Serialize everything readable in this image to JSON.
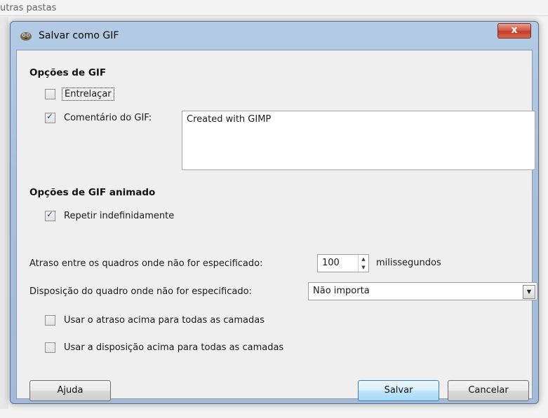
{
  "background": {
    "folder_text": "utras pastas"
  },
  "window": {
    "title": "Salvar como GIF",
    "close_label": "x"
  },
  "gif_options": {
    "section_title": "Opções de GIF",
    "interlace": {
      "label": "Entrelaçar",
      "checked": false
    },
    "comment": {
      "label": "Comentário do GIF:",
      "checked": true,
      "value": "Created with GIMP"
    }
  },
  "animated_options": {
    "section_title": "Opções de GIF animado",
    "loop": {
      "label": "Repetir indefinidamente",
      "checked": true
    },
    "delay": {
      "label": "Atraso entre os quadros onde não for especificado:",
      "value": "100",
      "unit": "milissegundos"
    },
    "disposal": {
      "label": "Disposição do quadro onde não for especificado:",
      "selected": "Não importa"
    },
    "use_delay_all": {
      "label": "Usar o atraso acima para todas as camadas",
      "checked": false
    },
    "use_disposal_all": {
      "label": "Usar a disposição acima para todas as camadas",
      "checked": false
    }
  },
  "buttons": {
    "help": "Ajuda",
    "save": "Salvar",
    "cancel": "Cancelar"
  }
}
